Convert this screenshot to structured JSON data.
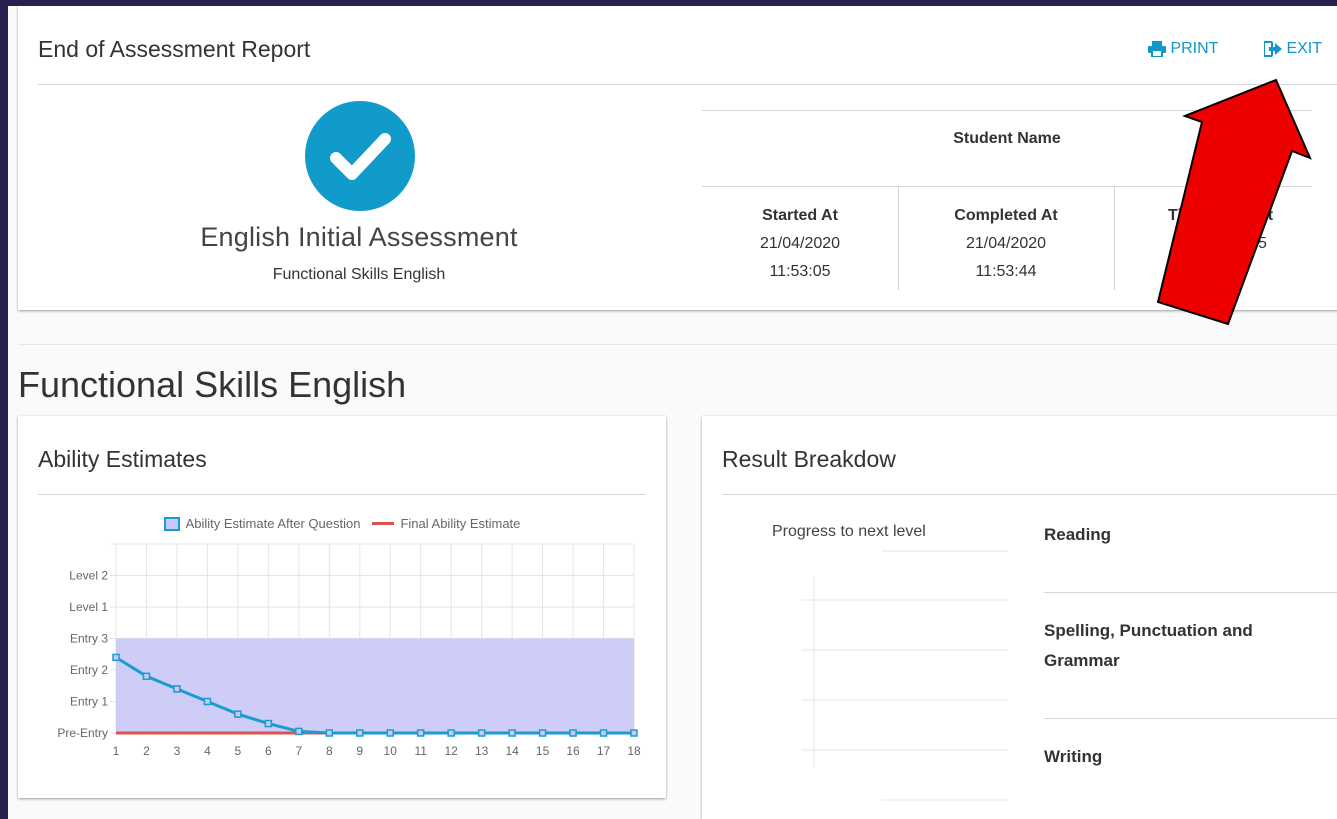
{
  "report": {
    "title": "End of Assessment Report",
    "print_label": "PRINT",
    "exit_label": "EXIT",
    "assessment_name": "English Initial Assessment",
    "assessment_subject": "Functional Skills English",
    "student_name_label": "Student Name",
    "started_label": "Started At",
    "started_date": "21/04/2020",
    "started_time": "11:53:05",
    "completed_label": "Completed At",
    "completed_date": "21/04/2020",
    "completed_time": "11:53:44",
    "time_spent_label_visible": "Ti",
    "time_spent_label_end": "nt",
    "time_spent_value_visible": "5"
  },
  "section_title": "Functional Skills English",
  "ability": {
    "title": "Ability Estimates",
    "legend_series_1": "Ability Estimate After Question",
    "legend_series_2": "Final Ability Estimate"
  },
  "breakdown": {
    "title": "Result Breakdow",
    "progress_label": "Progress to next level",
    "items": [
      "Reading",
      "Spelling, Punctuation and",
      "Grammar",
      "Writing"
    ]
  },
  "colors": {
    "accent": "#1197c9",
    "check": "#119bcb",
    "line": "#1a9ccf",
    "band": "#c9c8f6",
    "final": "#d9534f",
    "arrow": "#ee0000",
    "frame": "#2a2050"
  },
  "chart_data": {
    "type": "line",
    "x": [
      1,
      2,
      3,
      4,
      5,
      6,
      7,
      8,
      9,
      10,
      11,
      12,
      13,
      14,
      15,
      16,
      17,
      18
    ],
    "y_categories": [
      "Pre-Entry",
      "Entry 1",
      "Entry 2",
      "Entry 3",
      "Level 1",
      "Level 2"
    ],
    "series": [
      {
        "name": "Ability Estimate After Question",
        "values": [
          2.4,
          1.8,
          1.4,
          1.0,
          0.6,
          0.3,
          0.05,
          0,
          0,
          0,
          0,
          0,
          0,
          0,
          0,
          0,
          0,
          0
        ]
      },
      {
        "name": "Final Ability Estimate",
        "values": [
          0,
          0,
          0,
          0,
          0,
          0,
          0,
          0,
          0,
          0,
          0,
          0,
          0,
          0,
          0,
          0,
          0,
          0
        ]
      }
    ],
    "band_upper": 3,
    "ylim": [
      0,
      6
    ],
    "grid": true,
    "legend": "top"
  }
}
